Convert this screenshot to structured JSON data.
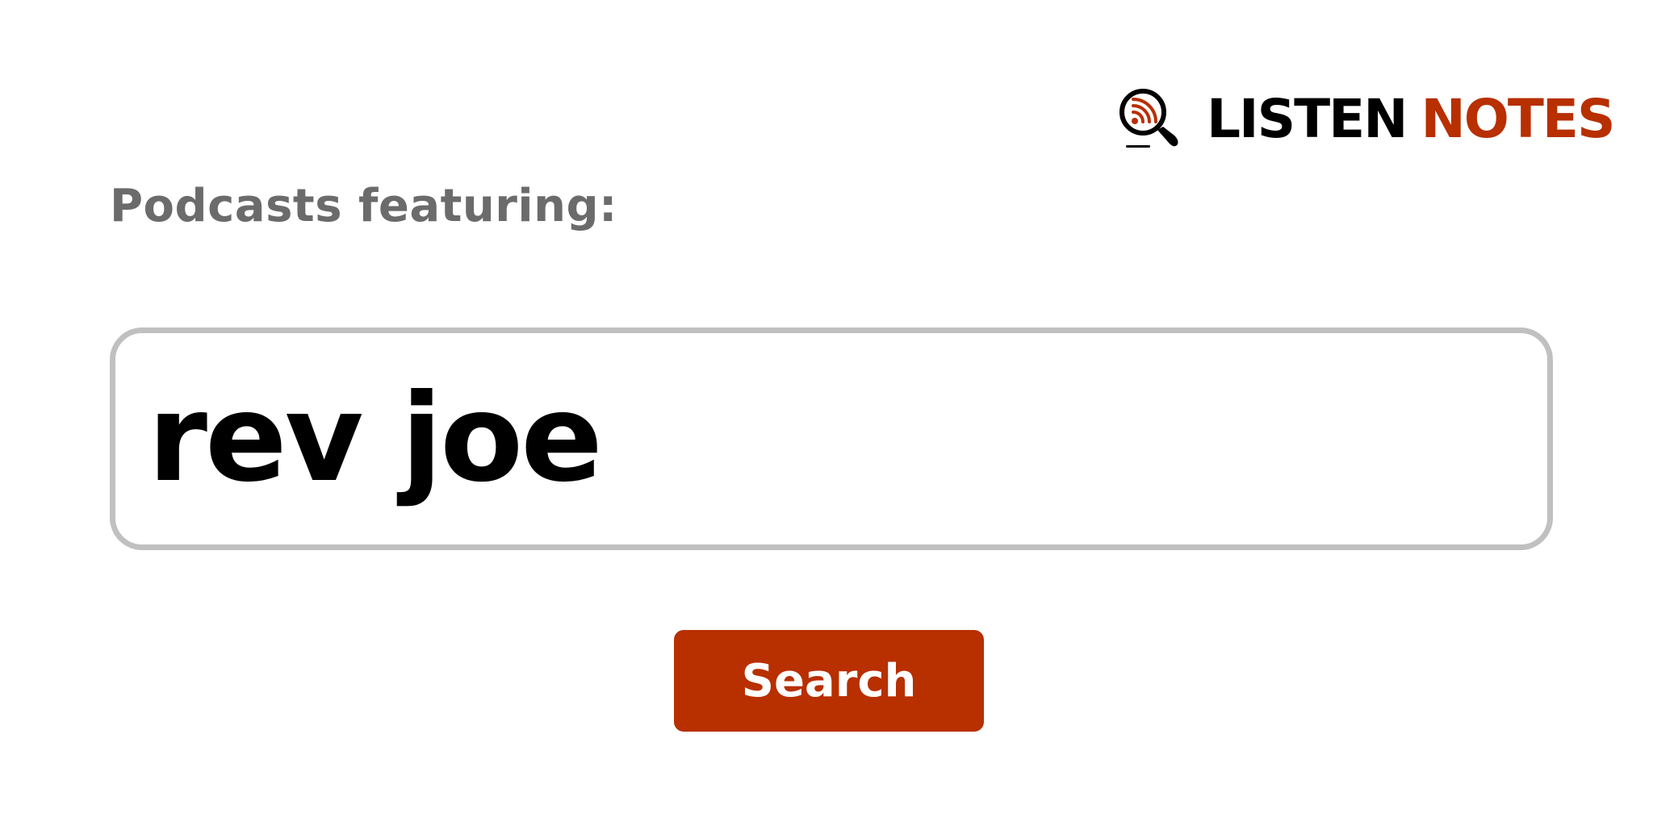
{
  "brand": {
    "word_1": "LISTEN",
    "word_2": "NOTES",
    "primary_color": "#000000",
    "accent_color": "#b82f00",
    "icon": "podcast-search-icon"
  },
  "heading": {
    "text": "Podcasts featuring:"
  },
  "search": {
    "value": "rev joe",
    "button_label": "Search"
  },
  "colors": {
    "button_bg": "#b82f00",
    "input_border": "#c0c0c0",
    "heading_text": "#6b6b6b"
  }
}
